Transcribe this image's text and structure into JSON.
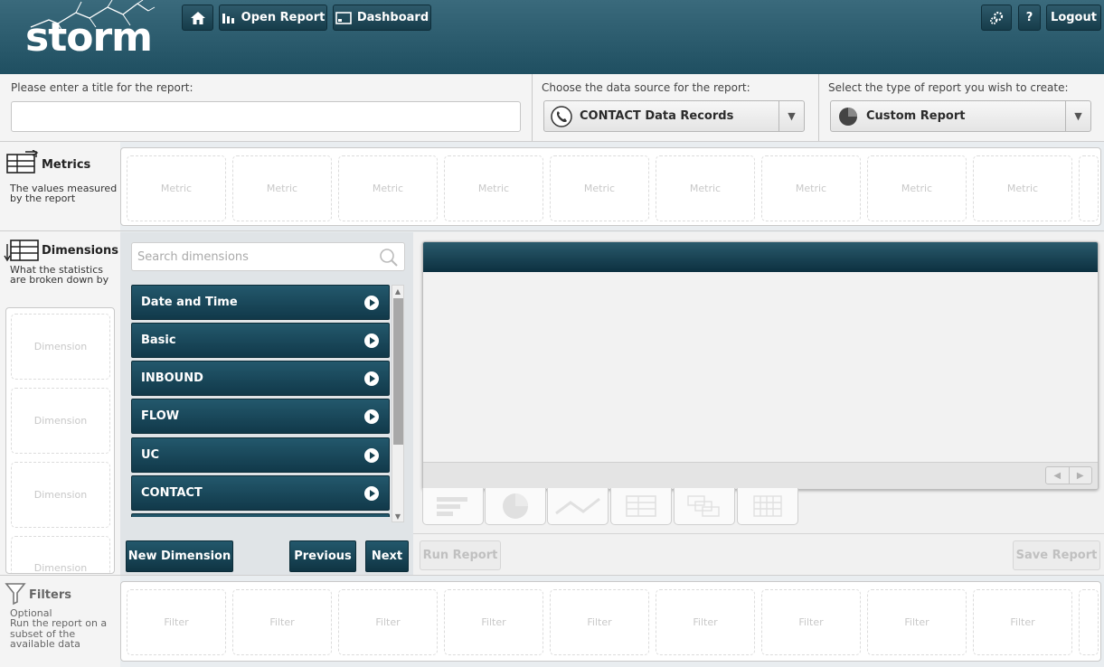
{
  "header": {
    "logo_text": "storm",
    "home_label": "",
    "open_report_label": "Open Report",
    "dashboard_label": "Dashboard",
    "help_label": "?",
    "logout_label": "Logout"
  },
  "config": {
    "title_label": "Please enter a title for the report:",
    "title_value": "",
    "source_label": "Choose the data source for the report:",
    "source_value": "CONTACT Data Records",
    "type_label": "Select the type of report you wish to create:",
    "type_value": "Custom Report"
  },
  "metrics": {
    "title": "Metrics",
    "desc_line1": "The values measured",
    "desc_line2": "by the report",
    "slot_label": "Metric",
    "slot_count": 10
  },
  "dimensions": {
    "title": "Dimensions",
    "desc_line1": "What the statistics",
    "desc_line2": "are broken down by",
    "slot_label": "Dimension",
    "search_placeholder": "Search dimensions",
    "items": [
      {
        "label": "Date and Time"
      },
      {
        "label": "Basic"
      },
      {
        "label": "INBOUND"
      },
      {
        "label": "FLOW"
      },
      {
        "label": "UC"
      },
      {
        "label": "CONTACT"
      }
    ],
    "new_label": "New Dimension",
    "previous_label": "Previous",
    "next_label": "Next"
  },
  "actions": {
    "run_label": "Run Report",
    "save_label": "Save Report"
  },
  "filters": {
    "title": "Filters",
    "desc_line1": "Optional",
    "desc_line2": "Run the report on a",
    "desc_line3": "subset of the",
    "desc_line4": "available data",
    "slot_label": "Filter"
  },
  "colors": {
    "header": "#1f4f61",
    "dim_button": "#11394a"
  }
}
